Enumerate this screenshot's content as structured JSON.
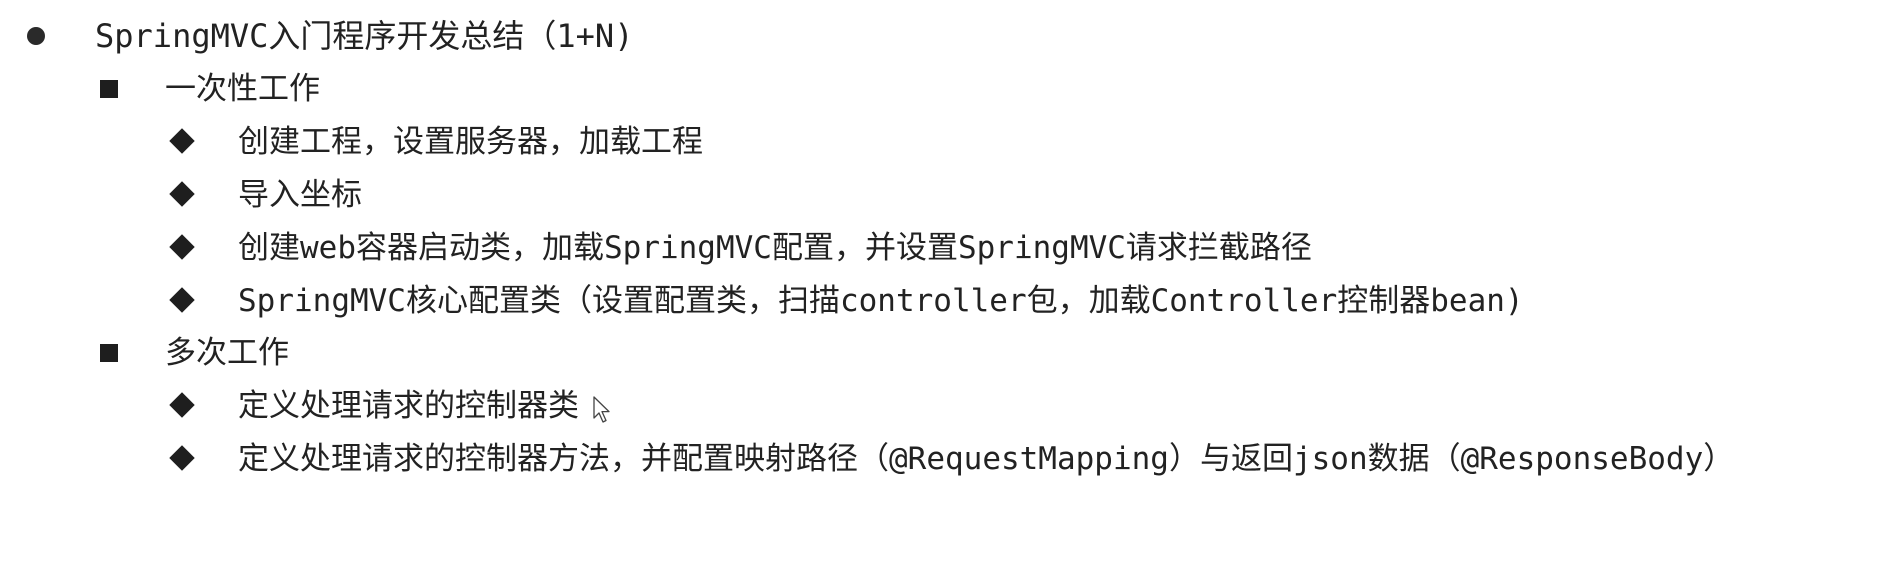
{
  "outline": {
    "title": "SpringMVC入门程序开发总结（1+N)",
    "once": {
      "heading": "一次性工作",
      "items": [
        "创建工程，设置服务器，加载工程",
        "导入坐标",
        "创建web容器启动类，加载SpringMVC配置，并设置SpringMVC请求拦截路径",
        "SpringMVC核心配置类（设置配置类，扫描controller包，加载Controller控制器bean)"
      ]
    },
    "many": {
      "heading": "多次工作",
      "items": [
        "定义处理请求的控制器类",
        "定义处理请求的控制器方法，并配置映射路径（@RequestMapping）与返回json数据（@ResponseBody）"
      ]
    }
  },
  "icons": {
    "level1": "disc-bullet-icon",
    "level2": "square-bullet-icon",
    "level3": "diamond-bullet-icon",
    "pointer": "mouse-pointer-icon"
  }
}
